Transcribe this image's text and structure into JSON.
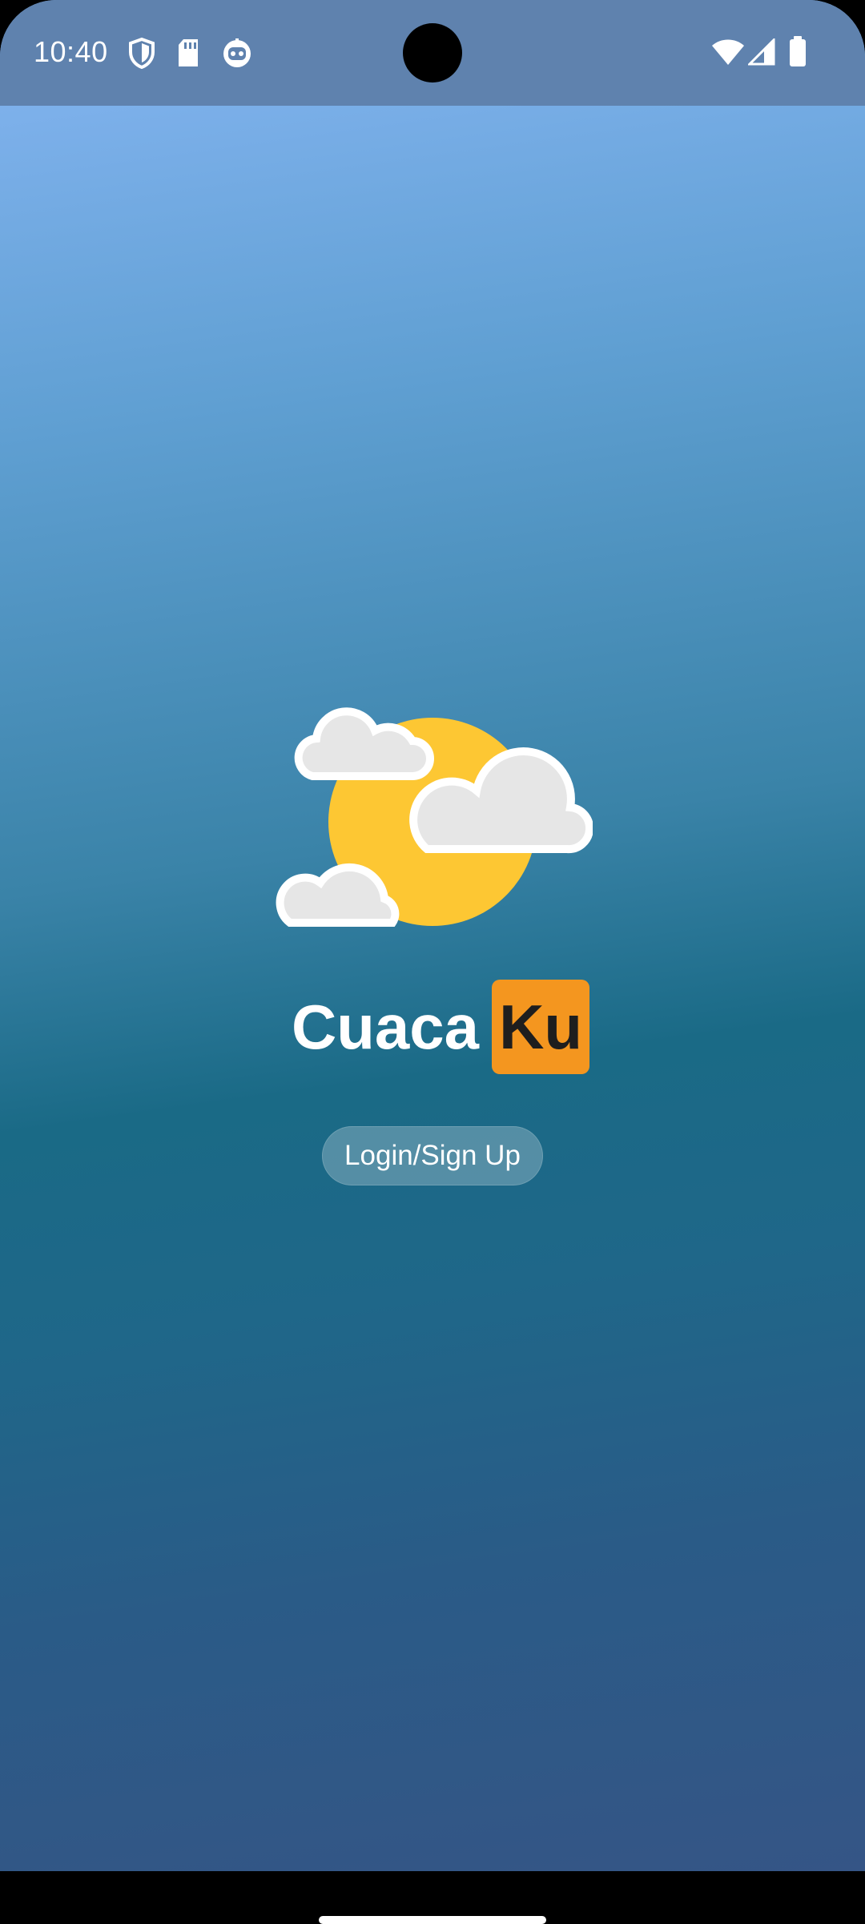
{
  "status_bar": {
    "time": "10:40",
    "left_icons": [
      "shield-icon",
      "sd-card-icon",
      "robot-face-icon"
    ],
    "right_icons": [
      "wifi-icon",
      "cell-signal-icon",
      "battery-icon"
    ]
  },
  "app": {
    "brand_main": "Cuaca",
    "brand_box": "Ku",
    "brand_box_color": "#f4961f",
    "hero_icon": "sun-behind-clouds-icon",
    "sun_color": "#fdc733",
    "cloud_color": "#e6e6e6"
  },
  "actions": {
    "login_label": "Login/Sign Up"
  }
}
